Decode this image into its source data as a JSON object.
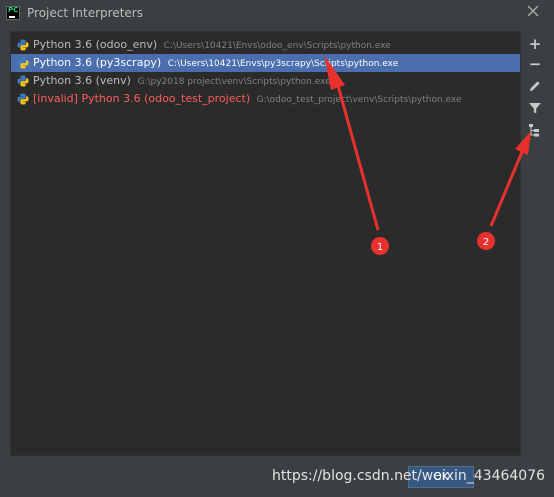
{
  "window": {
    "title": "Project Interpreters"
  },
  "interpreters": [
    {
      "name": "Python 3.6 (odoo_env)",
      "path": "C:\\Users\\10421\\Envs\\odoo_env\\Scripts\\python.exe",
      "selected": false,
      "invalid": false
    },
    {
      "name": "Python 3.6 (py3scrapy)",
      "path": "C:\\Users\\10421\\Envs\\py3scrapy\\Scripts\\python.exe",
      "selected": true,
      "invalid": false
    },
    {
      "name": "Python 3.6 (venv)",
      "path": "G:\\py2018 project\\venv\\Scripts\\python.exe",
      "selected": false,
      "invalid": false
    },
    {
      "name": "[invalid] Python 3.6 (odoo_test_project)",
      "path": "G:\\odoo_test_project\\venv\\Scripts\\python.exe",
      "selected": false,
      "invalid": true
    }
  ],
  "toolbar": {
    "add": "+",
    "remove": "−",
    "edit_icon": "pencil-icon",
    "filter_icon": "filter-icon",
    "tree_icon": "show-paths-tree-icon"
  },
  "annotations": {
    "marker1": "1",
    "marker2": "2",
    "color": "#e8312c"
  },
  "footer": {
    "button_label": "OK"
  },
  "watermark": "https://blog.csdn.net/weixin_43464076"
}
